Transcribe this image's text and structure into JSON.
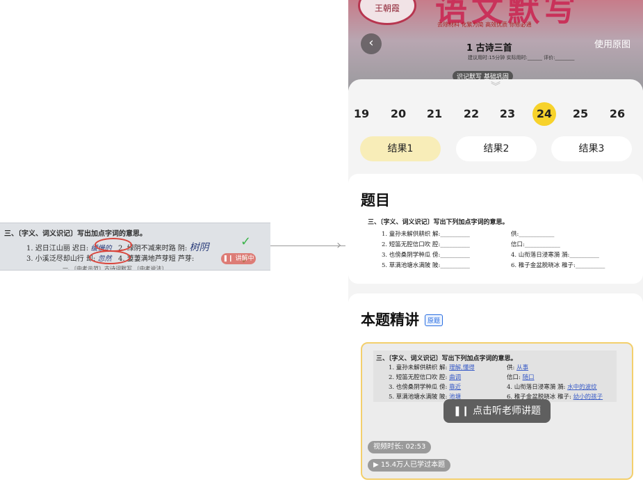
{
  "left_crop": {
    "heading": "三、〔字义、词义识记〕写出加点字词的意思。",
    "row1": "1. 迟日江山丽  迟日:",
    "row1_hand": "缓慢的",
    "row1b": "2. 绿阴不减来时路  阴:",
    "row1b_hand": "树阴",
    "row2": "3. 小溪泛尽却山行  却:",
    "row2_hand": "忽然",
    "row2b": "4. 萋萋满地芦芽短  芦芽:",
    "row3": "一、〔中考示范〕古诗词默写   〔中考说法〕",
    "badge": "讲解中"
  },
  "cover": {
    "logo": "王朝霞",
    "big_title": "语文默写",
    "sub": "去除材料 化繁为简 高效优质 你修必通",
    "lesson": "1 古诗三首",
    "time": "建议用时:15分钟   实际用时:______      评价:________",
    "tags": "识记默写  基础巩固",
    "use_original": "使用原图"
  },
  "pages": [
    "19",
    "20",
    "21",
    "22",
    "23",
    "24",
    "25",
    "26"
  ],
  "selected_page": "24",
  "results": [
    "结果1",
    "结果2",
    "结果3"
  ],
  "question": {
    "title": "题目",
    "heading": "三、〔字义、词义识记〕写出下列加点字词的意思。",
    "lines": [
      [
        "1. 童孙未解供耕织    解:__________",
        "供:____________"
      ],
      [
        "2. 短笛无腔信口吹    腔:__________",
        "信口:____________"
      ],
      [
        "3. 也傍桑阴学种瓜    傍:__________",
        "4. 山衔落日浸寒漪    漪:__________"
      ],
      [
        "5. 草满池塘水满陂    陂:__________",
        "6. 稚子金盆脱晓冰    稚子:__________"
      ]
    ]
  },
  "explain": {
    "title": "本题精讲",
    "badge": "原题",
    "heading": "三、〔字义、词义识记〕写出下列加点字词的意思。",
    "lines": [
      [
        "1. 童孙未解供耕织  解:",
        "理解,懂得",
        "供:",
        "从事"
      ],
      [
        "2. 短笛无腔信口吹  腔:",
        "曲调",
        "信口:",
        "随口"
      ],
      [
        "3. 也傍桑阴学种瓜  傍:",
        "靠近",
        "4. 山衔落日浸寒漪  漪:",
        "水中的波纹"
      ],
      [
        "5. 草满池塘水满陂  陂:",
        "池塘",
        "6. 稚子金盆脱晓冰  稚子:",
        "幼小的孩子"
      ]
    ],
    "play_label": "点击听老师讲题",
    "duration": "视频时长: 02:53",
    "learned": "15.4万人已学过本题"
  },
  "colors": {
    "accent_yellow": "#f7d22b",
    "result_selected": "#f8edb8",
    "video_border": "#f3cf6c"
  }
}
